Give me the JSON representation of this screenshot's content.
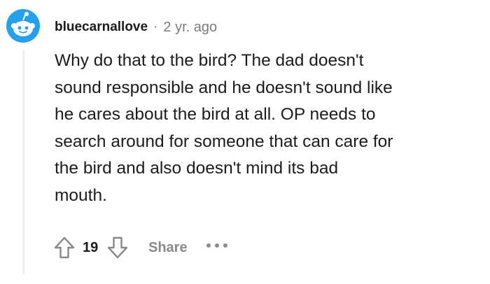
{
  "comment": {
    "author": "bluecarnallove",
    "separator": "·",
    "age": "2 yr. ago",
    "body": "Why do that to the bird? The dad doesn't\nsound responsible and he doesn't sound like\nhe cares about the bird at all. OP needs to\nsearch around for someone that can care for\nthe bird and also doesn't mind its bad\nmouth.",
    "avatar_icon": "snoo-avatar-icon",
    "actions": {
      "upvote_icon": "arrow-up-icon",
      "score": "19",
      "downvote_icon": "arrow-down-icon",
      "share_label": "Share",
      "more_icon": "ellipsis-icon"
    }
  },
  "colors": {
    "avatar_blue": "#24a0ed",
    "text": "#1c1c1c",
    "muted": "#7c7c7c",
    "action_gray": "#878a8c",
    "thread_line": "#edeff1"
  }
}
